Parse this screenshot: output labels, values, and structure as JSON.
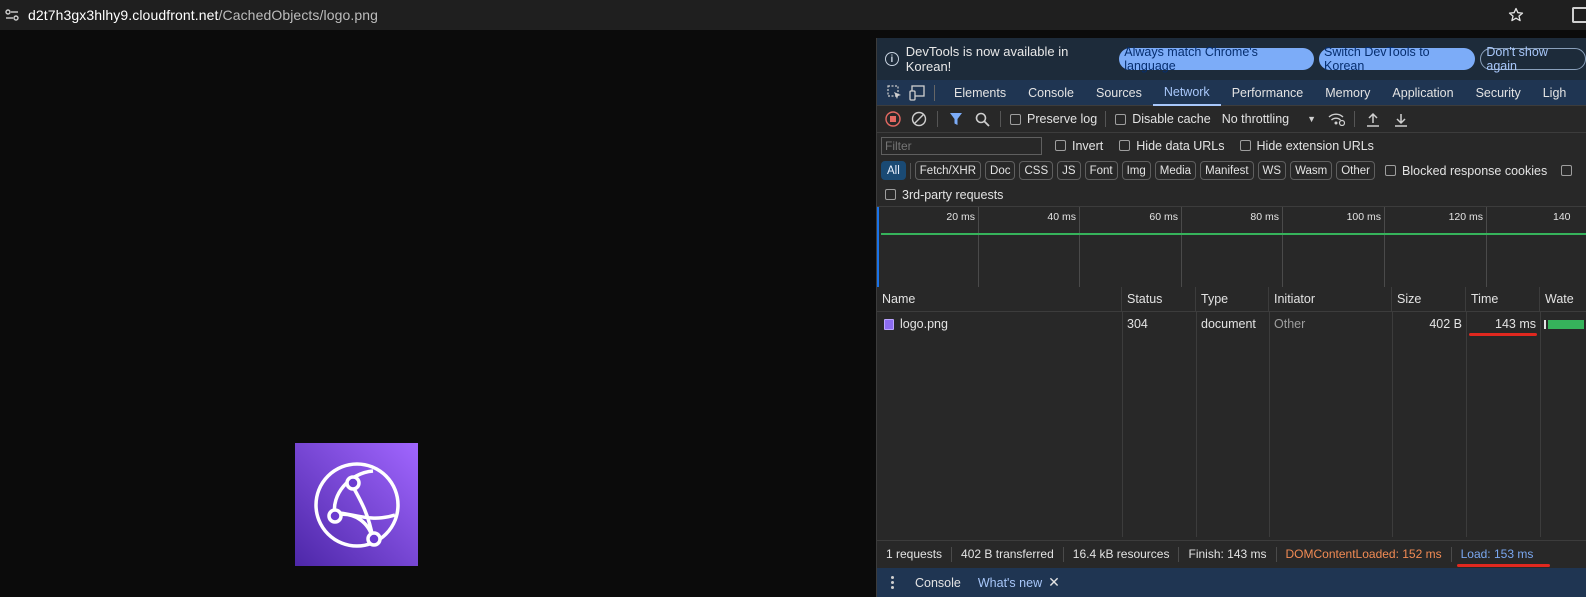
{
  "address_bar": {
    "url_host": "d2t7h3gx3hlhy9.cloudfront.net",
    "url_path": "/CachedObjects/logo.png"
  },
  "infobar": {
    "message": "DevTools is now available in Korean!",
    "btn_match": "Always match Chrome's language",
    "btn_switch": "Switch DevTools to Korean",
    "btn_dismiss": "Don't show again"
  },
  "tabs": [
    "Elements",
    "Console",
    "Sources",
    "Network",
    "Performance",
    "Memory",
    "Application",
    "Security",
    "Ligh"
  ],
  "toolbar": {
    "preserve_log": "Preserve log",
    "disable_cache": "Disable cache",
    "throttling": "No throttling"
  },
  "filterbar": {
    "placeholder": "Filter",
    "invert": "Invert",
    "hide_data_urls": "Hide data URLs",
    "hide_extension_urls": "Hide extension URLs"
  },
  "type_filters": [
    "All",
    "Fetch/XHR",
    "Doc",
    "CSS",
    "JS",
    "Font",
    "Img",
    "Media",
    "Manifest",
    "WS",
    "Wasm",
    "Other"
  ],
  "blocked_response_cookies": "Blocked response cookies",
  "third_party": "3rd-party requests",
  "overview_ticks": [
    "20 ms",
    "40 ms",
    "60 ms",
    "80 ms",
    "100 ms",
    "120 ms",
    "140"
  ],
  "columns": [
    "Name",
    "Status",
    "Type",
    "Initiator",
    "Size",
    "Time",
    "Wate"
  ],
  "requests": [
    {
      "name": "logo.png",
      "status": "304",
      "type": "document",
      "initiator": "Other",
      "size": "402 B",
      "time": "143 ms"
    }
  ],
  "status_bar": {
    "requests": "1 requests",
    "transferred": "402 B transferred",
    "resources": "16.4 kB resources",
    "finish": "Finish: 143 ms",
    "dom_content_loaded": "DOMContentLoaded: 152 ms",
    "load": "Load: 153 ms"
  },
  "drawer": {
    "console": "Console",
    "whats_new": "What's new"
  },
  "colors": {
    "dcl": "#f28b54",
    "load": "#7aa7f0",
    "annotation": "#e0281f",
    "logo_gradient": [
      "#4d27a8",
      "#a166ff"
    ]
  }
}
